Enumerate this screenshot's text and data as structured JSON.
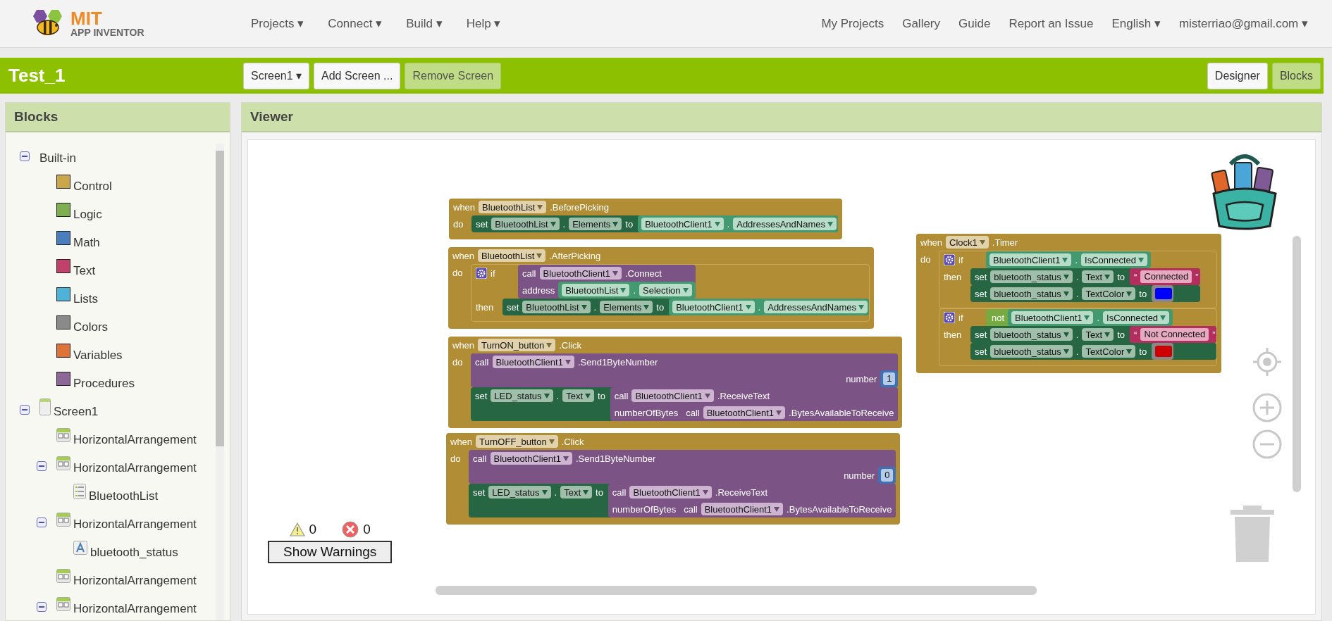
{
  "header": {
    "logo": {
      "line1": "MIT",
      "line2": "APP INVENTOR"
    },
    "menus": [
      "Projects ▾",
      "Connect ▾",
      "Build ▾",
      "Help ▾"
    ],
    "links": [
      "My Projects",
      "Gallery",
      "Guide",
      "Report an Issue",
      "English ▾",
      "misterriao@gmail.com ▾"
    ]
  },
  "project_bar": {
    "title": "Test_1",
    "buttons": [
      {
        "label": "Screen1 ▾",
        "disabled": false
      },
      {
        "label": "Add Screen ...",
        "disabled": false
      },
      {
        "label": "Remove Screen",
        "disabled": true
      }
    ],
    "views": [
      {
        "label": "Designer",
        "selected": false
      },
      {
        "label": "Blocks",
        "selected": true
      }
    ]
  },
  "sidebar": {
    "title": "Blocks",
    "tree": [
      {
        "label": "Built-in",
        "expanded": true,
        "children": [
          {
            "label": "Control",
            "kind": "category",
            "color": "#c9a74a"
          },
          {
            "label": "Logic",
            "kind": "category",
            "color": "#7eaf4f"
          },
          {
            "label": "Math",
            "kind": "category",
            "color": "#4a7ebe"
          },
          {
            "label": "Text",
            "kind": "category",
            "color": "#c2406c"
          },
          {
            "label": "Lists",
            "kind": "category",
            "color": "#4fb3d9"
          },
          {
            "label": "Colors",
            "kind": "category",
            "color": "#8a8a8a"
          },
          {
            "label": "Variables",
            "kind": "category",
            "color": "#de7237"
          },
          {
            "label": "Procedures",
            "kind": "category",
            "color": "#8e6799"
          }
        ]
      },
      {
        "label": "Screen1",
        "kind": "screen",
        "expanded": true,
        "children": [
          {
            "label": "HorizontalArrangement",
            "kind": "arrangement"
          },
          {
            "label": "HorizontalArrangement",
            "kind": "arrangement",
            "expanded": true,
            "children": [
              {
                "label": "BluetoothList",
                "kind": "listpicker"
              }
            ]
          },
          {
            "label": "HorizontalArrangement",
            "kind": "arrangement",
            "expanded": true,
            "children": [
              {
                "label": "bluetooth_status",
                "kind": "label"
              }
            ]
          },
          {
            "label": "HorizontalArrangement",
            "kind": "arrangement"
          },
          {
            "label": "HorizontalArrangement",
            "kind": "arrangement",
            "expanded": true
          }
        ]
      }
    ]
  },
  "viewer": {
    "title": "Viewer",
    "warnings": {
      "warning_count": "0",
      "error_count": "0",
      "button": "Show Warnings"
    }
  },
  "workspace": {
    "blocks": [
      {
        "kind": "event",
        "keyword": "when",
        "component": "BluetoothList",
        "event": ".BeforePicking",
        "do_label": "do",
        "body": [
          {
            "kind": "set",
            "keyword": "set",
            "component": "BluetoothList",
            "dot": ".",
            "property": "Elements",
            "to_label": "to",
            "value": {
              "kind": "getter",
              "component": "BluetoothClient1",
              "dot": ".",
              "property": "AddressesAndNames"
            }
          }
        ]
      },
      {
        "kind": "event",
        "keyword": "when",
        "component": "BluetoothList",
        "event": ".AfterPicking",
        "do_label": "do",
        "body": [
          {
            "kind": "if",
            "keyword": "if",
            "then_label": "then",
            "condition": {
              "kind": "call",
              "keyword": "call",
              "component": "BluetoothClient1",
              "method": ".Connect",
              "args": [
                {
                  "name": "address",
                  "value": {
                    "kind": "getter",
                    "component": "BluetoothList",
                    "dot": ".",
                    "property": "Selection"
                  }
                }
              ]
            },
            "body": [
              {
                "kind": "set",
                "keyword": "set",
                "component": "BluetoothList",
                "dot": ".",
                "property": "Elements",
                "to_label": "to",
                "value": {
                  "kind": "getter",
                  "component": "BluetoothClient1",
                  "dot": ".",
                  "property": "AddressesAndNames"
                }
              }
            ]
          }
        ]
      },
      {
        "kind": "event",
        "keyword": "when",
        "component": "TurnON_button",
        "event": ".Click",
        "do_label": "do",
        "body": [
          {
            "kind": "call",
            "keyword": "call",
            "component": "BluetoothClient1",
            "method": ".Send1ByteNumber",
            "args": [
              {
                "name": "number",
                "value": {
                  "kind": "number",
                  "text": "1"
                }
              }
            ]
          },
          {
            "kind": "set",
            "keyword": "set",
            "component": "LED_status",
            "dot": ".",
            "property": "Text",
            "to_label": "to",
            "value": {
              "kind": "call",
              "keyword": "call",
              "component": "BluetoothClient1",
              "method": ".ReceiveText",
              "args": [
                {
                  "name": "numberOfBytes",
                  "value": {
                    "kind": "call",
                    "keyword": "call",
                    "component": "BluetoothClient1",
                    "method": ".BytesAvailableToReceive"
                  }
                }
              ]
            }
          }
        ]
      },
      {
        "kind": "event",
        "keyword": "when",
        "component": "TurnOFF_button",
        "event": ".Click",
        "do_label": "do",
        "body": [
          {
            "kind": "call",
            "keyword": "call",
            "component": "BluetoothClient1",
            "method": ".Send1ByteNumber",
            "args": [
              {
                "name": "number",
                "value": {
                  "kind": "number",
                  "text": "0"
                }
              }
            ]
          },
          {
            "kind": "set",
            "keyword": "set",
            "component": "LED_status",
            "dot": ".",
            "property": "Text",
            "to_label": "to",
            "value": {
              "kind": "call",
              "keyword": "call",
              "component": "BluetoothClient1",
              "method": ".ReceiveText",
              "args": [
                {
                  "name": "numberOfBytes",
                  "value": {
                    "kind": "call",
                    "keyword": "call",
                    "component": "BluetoothClient1",
                    "method": ".BytesAvailableToReceive"
                  }
                }
              ]
            }
          }
        ]
      },
      {
        "kind": "event",
        "keyword": "when",
        "component": "Clock1",
        "event": ".Timer",
        "do_label": "do",
        "body": [
          {
            "kind": "if",
            "keyword": "if",
            "then_label": "then",
            "condition": {
              "kind": "getter",
              "component": "BluetoothClient1",
              "dot": ".",
              "property": "IsConnected"
            },
            "body": [
              {
                "kind": "set",
                "keyword": "set",
                "component": "bluetooth_status",
                "dot": ".",
                "property": "Text",
                "to_label": "to",
                "value": {
                  "kind": "text",
                  "open": "“",
                  "text": "Connected",
                  "close": "”"
                }
              },
              {
                "kind": "set",
                "keyword": "set",
                "component": "bluetooth_status",
                "dot": ".",
                "property": "TextColor",
                "to_label": "to",
                "value": {
                  "kind": "color",
                  "color": "#0000ff"
                }
              }
            ]
          },
          {
            "kind": "if",
            "keyword": "if",
            "then_label": "then",
            "condition": {
              "kind": "not",
              "keyword": "not",
              "operand": {
                "kind": "getter",
                "component": "BluetoothClient1",
                "dot": ".",
                "property": "IsConnected"
              }
            },
            "body": [
              {
                "kind": "set",
                "keyword": "set",
                "component": "bluetooth_status",
                "dot": ".",
                "property": "Text",
                "to_label": "to",
                "value": {
                  "kind": "text",
                  "open": "“",
                  "text": "Not Connected",
                  "close": "”"
                }
              },
              {
                "kind": "set",
                "keyword": "set",
                "component": "bluetooth_status",
                "dot": ".",
                "property": "TextColor",
                "to_label": "to",
                "value": {
                  "kind": "color",
                  "color": "#cc0000"
                }
              }
            ]
          }
        ]
      }
    ]
  }
}
